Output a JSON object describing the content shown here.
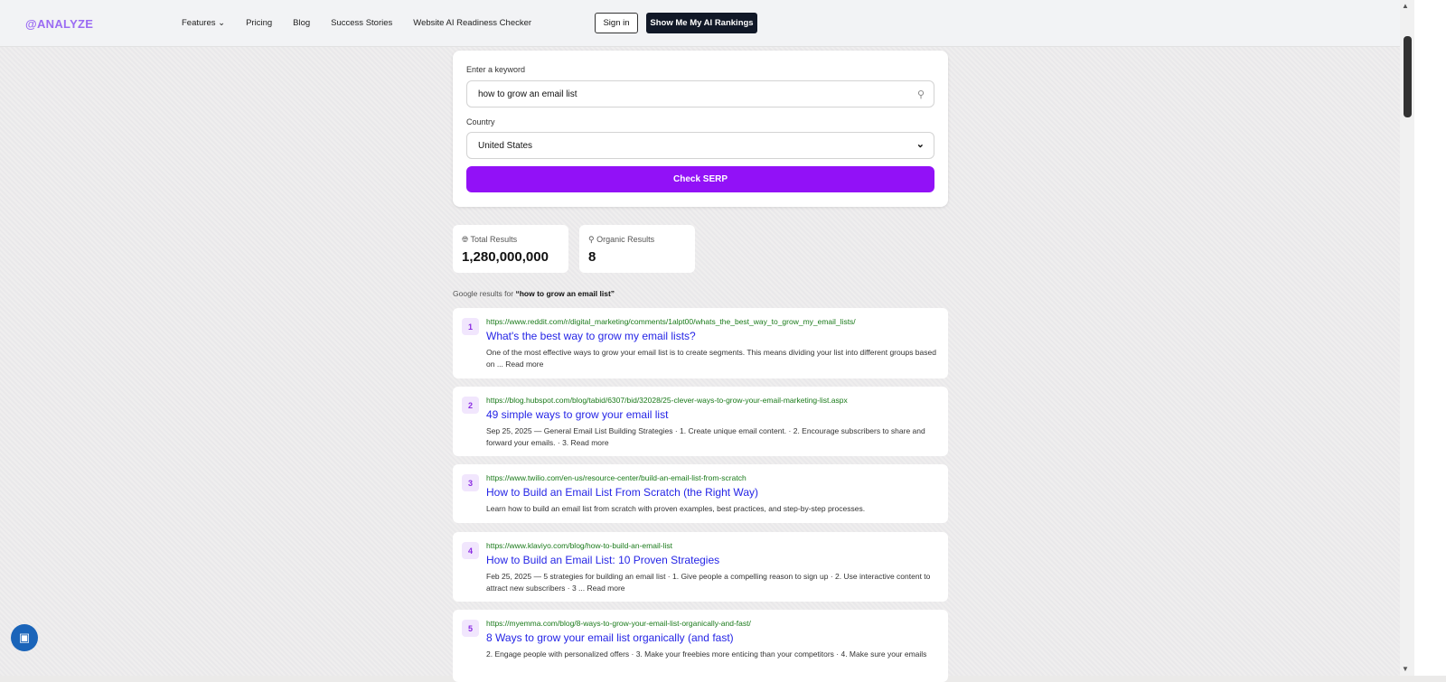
{
  "nav": {
    "logo": "@ANALYZE",
    "links": [
      "Features ⌄",
      "Pricing",
      "Blog",
      "Success Stories",
      "Website AI Readiness Checker"
    ],
    "signin": "Sign in",
    "cta": "Show Me My AI Rankings"
  },
  "form": {
    "keyword_label": "Enter a keyword",
    "keyword_value": "how to grow an email list",
    "country_label": "Country",
    "country_value": "United States",
    "submit": "Check SERP"
  },
  "stats": [
    {
      "label": "Total Results",
      "value": "1,280,000,000"
    },
    {
      "label": "Organic Results",
      "value": "8"
    }
  ],
  "results_heading": {
    "prefix": "Google results for",
    "query": "“how to grow an email list”"
  },
  "results": [
    {
      "rank": "1",
      "url": "https://www.reddit.com/r/digital_marketing/comments/1alpt00/whats_the_best_way_to_grow_my_email_lists/",
      "title": "What's the best way to grow my email lists?",
      "snippet": "One of the most effective ways to grow your email list is to create segments. This means dividing your list into different groups based on ... Read more"
    },
    {
      "rank": "2",
      "url": "https://blog.hubspot.com/blog/tabid/6307/bid/32028/25-clever-ways-to-grow-your-email-marketing-list.aspx",
      "title": "49 simple ways to grow your email list",
      "snippet": "Sep 25, 2025 — General Email List Building Strategies · 1. Create unique email content. · 2. Encourage subscribers to share and forward your emails. · 3. Read more"
    },
    {
      "rank": "3",
      "url": "https://www.twilio.com/en-us/resource-center/build-an-email-list-from-scratch",
      "title": "How to Build an Email List From Scratch (the Right Way)",
      "snippet": "Learn how to build an email list from scratch with proven examples, best practices, and step-by-step processes."
    },
    {
      "rank": "4",
      "url": "https://www.klaviyo.com/blog/how-to-build-an-email-list",
      "title": "How to Build an Email List: 10 Proven Strategies",
      "snippet": "Feb 25, 2025 — 5 strategies for building an email list · 1. Give people a compelling reason to sign up · 2. Use interactive content to attract new subscribers · 3 ... Read more"
    },
    {
      "rank": "5",
      "url": "https://myemma.com/blog/8-ways-to-grow-your-email-list-organically-and-fast/",
      "title": "8 Ways to grow your email list organically (and fast)",
      "snippet": "2. Engage people with personalized offers · 3. Make your freebies more enticing than your competitors · 4. Make sure your emails"
    }
  ]
}
